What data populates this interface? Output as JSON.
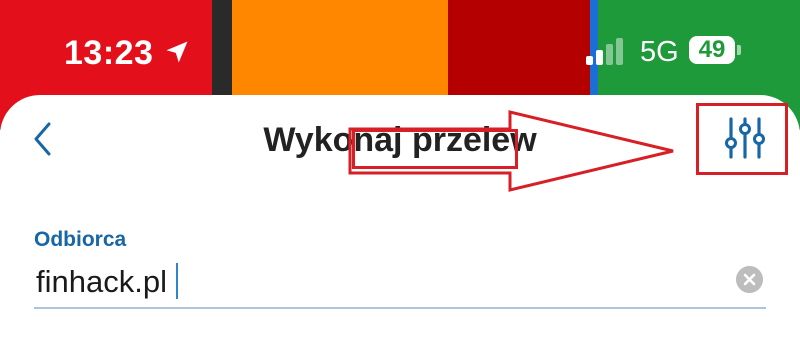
{
  "status_bar": {
    "time": "13:23",
    "network": "5G",
    "battery_level": "49",
    "icons": [
      "location-arrow-icon",
      "cellular-signal-icon",
      "battery-icon"
    ]
  },
  "wallpaper_colors": [
    "#e3101c",
    "#2a2a2a",
    "#ff8700",
    "#b50000",
    "#1a6ed6",
    "#1e9a3a"
  ],
  "header": {
    "title": "Wykonaj przelew",
    "back_icon": "chevron-left-icon",
    "settings_icon": "sliders-icon"
  },
  "form": {
    "recipient_label": "Odbiorca",
    "recipient_value": "finhack.pl",
    "clear_icon": "clear-circle-icon"
  },
  "colors": {
    "accent": "#1767a6",
    "annotation": "#d71f26",
    "title_text": "#222222"
  }
}
